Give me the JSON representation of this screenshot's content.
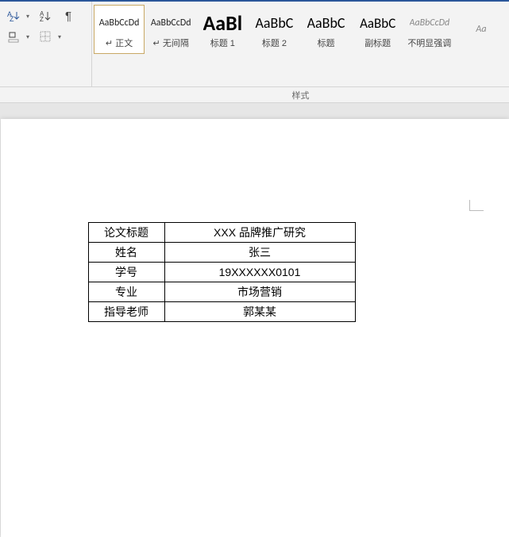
{
  "ribbon": {
    "styles_label": "样式",
    "styles": [
      {
        "preview": "AaBbCcDd",
        "name": "↵ 正文",
        "size": "12px",
        "selected": true
      },
      {
        "preview": "AaBbCcDd",
        "name": "↵ 无间隔",
        "size": "12px"
      },
      {
        "preview": "AaBl",
        "name": "标题 1",
        "size": "26px",
        "bold": true,
        "color": "#000"
      },
      {
        "preview": "AaBbC",
        "name": "标题 2",
        "size": "18px",
        "color": "#000"
      },
      {
        "preview": "AaBbC",
        "name": "标题",
        "size": "18px",
        "color": "#000"
      },
      {
        "preview": "AaBbC",
        "name": "副标题",
        "size": "17px",
        "color": "#000"
      },
      {
        "preview": "AaBbCcDd",
        "name": "不明显强调",
        "size": "12px",
        "italic": true,
        "color": "#888"
      },
      {
        "preview": "Aa",
        "name": "",
        "size": "12px",
        "italic": true,
        "color": "#888"
      }
    ]
  },
  "document": {
    "table": [
      {
        "label": "论文标题",
        "value": "XXX 品牌推广研究"
      },
      {
        "label": "姓名",
        "value": "张三"
      },
      {
        "label": "学号",
        "value": "19XXXXXX0101"
      },
      {
        "label": "专业",
        "value": "市场营销"
      },
      {
        "label": "指导老师",
        "value": "郭某某"
      }
    ]
  }
}
